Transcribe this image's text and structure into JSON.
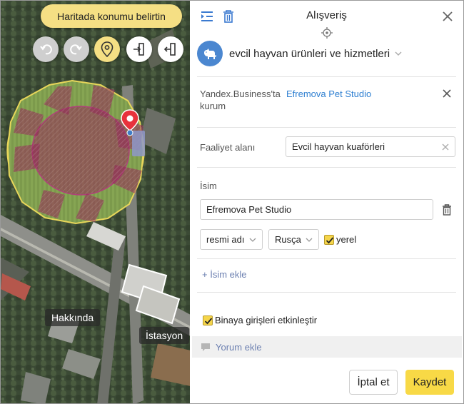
{
  "map": {
    "hint": "Haritada konumu belirtin",
    "labels": [
      "Hakkında",
      "İstasyon"
    ],
    "buttons": [
      {
        "icon": "undo-icon",
        "state": "disabled"
      },
      {
        "icon": "redo-icon",
        "state": "disabled"
      },
      {
        "icon": "location-pin-icon",
        "state": "active"
      },
      {
        "icon": "entrance-icon",
        "state": "normal"
      },
      {
        "icon": "exit-icon",
        "state": "normal"
      }
    ]
  },
  "panel": {
    "title": "Alışveriş",
    "category": {
      "label": "evcil hayvan ürünleri ve hizmetleri",
      "icon": "dog-icon",
      "color": "#4b87d0"
    },
    "business": {
      "label": "Yandex.Business'ta kurum",
      "link": "Efremova Pet Studio"
    },
    "activity": {
      "label": "Faaliyet alanı",
      "value": "Evcil hayvan kuaförleri"
    },
    "name": {
      "label": "İsim",
      "value": "Efremova Pet Studio",
      "type": "resmi adı",
      "language": "Rusça",
      "local_label": "yerel",
      "local_checked": true
    },
    "add_name": "+ İsim ekle",
    "entrances": {
      "label": "Binaya girişleri etkinleştir",
      "checked": true
    },
    "comment": "Yorum ekle",
    "cancel": "İptal et",
    "save": "Kaydet"
  },
  "colors": {
    "accent": "#f8d946",
    "link": "#2e7fd1",
    "pin": "#e8323c"
  }
}
